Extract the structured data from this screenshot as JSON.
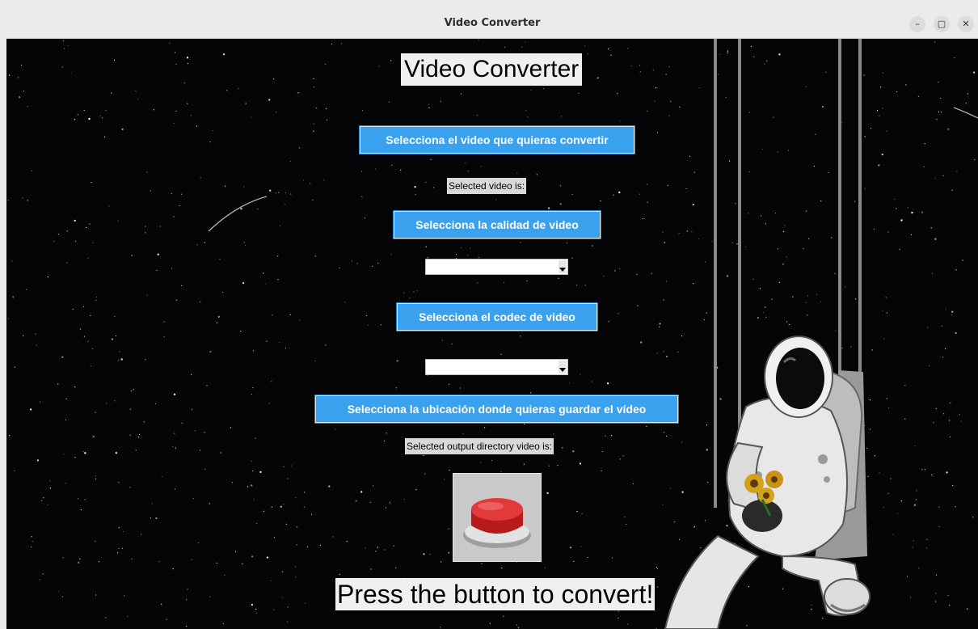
{
  "window": {
    "title": "Video Converter",
    "controls": {
      "minimize": "–",
      "maximize": "▢",
      "close": "✕"
    }
  },
  "app": {
    "heading": "Video Converter",
    "select_video_button": "Selecciona el video que quieras convertir",
    "selected_video_label": "Selected video is:",
    "select_quality_button": "Selecciona la calidad de video",
    "quality_combo_value": "",
    "select_codec_button": "Selecciona el codec de video",
    "codec_combo_value": "",
    "select_location_button": "Selecciona la ubicación donde quieras guardar el vídeo",
    "selected_output_label": "Selected output directory video is:",
    "footer_text": "Press the button to convert!"
  },
  "colors": {
    "button_bg": "#3aa1ee",
    "space_bg": "#050507",
    "convert_button": "#d32626"
  }
}
